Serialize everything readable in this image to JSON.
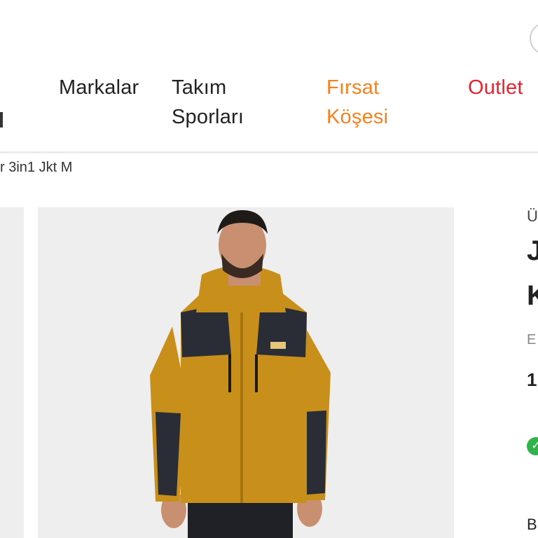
{
  "nav": {
    "items": [
      {
        "label_line1": "Markalar",
        "label_line2": ""
      },
      {
        "label_line1": "Takım",
        "label_line2": "Sporları"
      },
      {
        "label_line1": "Fırsat",
        "label_line2": "Köşesi"
      },
      {
        "label_line1": "Outlet",
        "label_line2": ""
      }
    ],
    "deal_color": "#f58220",
    "outlet_color": "#e8232e"
  },
  "breadcrumb": {
    "current": "r 3in1 Jkt M"
  },
  "product": {
    "image_icon": "jacket-product-photo",
    "jacket_color": "#c8901a",
    "panel_color": "#2a2d35",
    "brand_partial": "Ü",
    "title_line1_partial": "J",
    "title_line2_partial": "K",
    "review_partial": "E",
    "price_partial": "1",
    "stock_icon": "check-circle-icon",
    "size_partial": "B"
  }
}
